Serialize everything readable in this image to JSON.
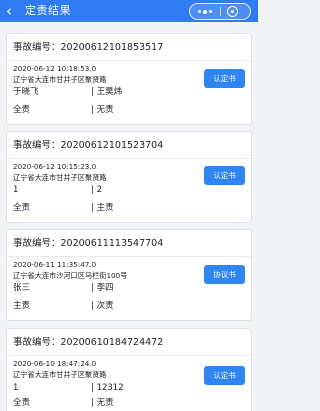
{
  "header": {
    "back_icon": "‹",
    "title": "定责结果"
  },
  "colors": {
    "accent": "#2f7bf0",
    "button": "#2f86f0",
    "background": "#f1f3f6"
  },
  "records": [
    {
      "no_label": "事故编号：20200612101853517",
      "datetime": "2020-06-12 10:18:53.0",
      "address": "辽宁省大连市甘井子区聚贤路",
      "party_a": "于晓飞",
      "party_b": "| 王昊炜",
      "resp_a": "全责",
      "resp_b": "| 无责",
      "action_label": "认定书"
    },
    {
      "no_label": "事故编号：20200612101523704",
      "datetime": "2020-06-12 10:15:23.0",
      "address": "辽宁省大连市甘井子区聚贤路",
      "party_a": "1",
      "party_b": "| 2",
      "resp_a": "全责",
      "resp_b": "| 主责",
      "action_label": "认定书"
    },
    {
      "no_label": "事故编号：20200611113547704",
      "datetime": "2020-06-11 11:35:47.0",
      "address": "辽宁省大连市沙河口区马栏街100号",
      "party_a": "张三",
      "party_b": "| 李四",
      "resp_a": "主责",
      "resp_b": "| 次责",
      "action_label": "协议书"
    },
    {
      "no_label": "事故编号：20200610184724472",
      "datetime": "2020-06-10 18:47:24.0",
      "address": "辽宁省大连市甘井子区聚贤路",
      "party_a": "1",
      "party_b": "| 12312",
      "resp_a": "全责",
      "resp_b": "| 无责",
      "action_label": "认定书"
    }
  ]
}
